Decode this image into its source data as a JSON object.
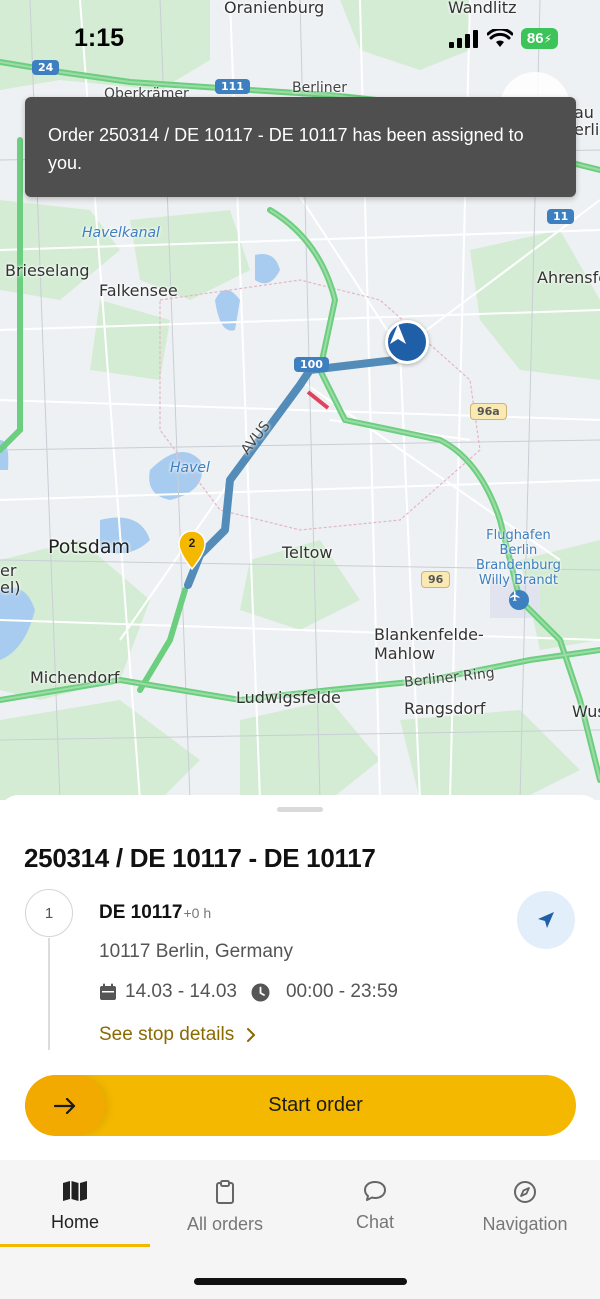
{
  "status_bar": {
    "time": "1:15",
    "battery": "86"
  },
  "map": {
    "labels": {
      "oranienburg": "Oranienburg",
      "wandlitz": "Wandlitz",
      "oberkramer": "Oberkrämer",
      "berlin_ring_top": "Berliner",
      "brieselang": "Brieselang",
      "falkensee": "Falkensee",
      "havelkanal": "Havelkanal",
      "ahrensfelde": "Ahrensfe",
      "havel": "Havel",
      "avus": "AVUS",
      "potsdam": "Potsdam",
      "teltow": "Teltow",
      "airport": "Flughafen\nBerlin\nBrandenburg\nWilly Brandt",
      "blankenfelde": "Blankenfelde-\nMahlow",
      "michendorf": "Michendorf",
      "ludwigsfelde": "Ludwigsfelde",
      "berliner_ring": "Berliner Ring",
      "rangsdorf": "Rangsdorf",
      "wus": "Wus",
      "left_edge": "er\nel)",
      "right_top": "au\nerli"
    },
    "shields": {
      "a24": "24",
      "a111": "111",
      "a11": "11",
      "a100": "100",
      "b96a": "96a",
      "b96": "96"
    },
    "stop_pin_number": "2"
  },
  "toast": {
    "message": "Order 250314 / DE 10117 - DE 10117 has been assigned to you."
  },
  "order": {
    "title": "250314 / DE 10117 - DE 10117",
    "stop": {
      "index": "1",
      "name": "DE 10117",
      "offset": "+0 h",
      "address": "10117 Berlin, Germany",
      "date_range": "14.03 - 14.03",
      "time_range": "00:00 - 23:59",
      "details_label": "See stop details"
    },
    "start_label": "Start order"
  },
  "tabs": [
    {
      "label": "Home",
      "icon": "map-icon",
      "active": true
    },
    {
      "label": "All orders",
      "icon": "clipboard-icon",
      "active": false
    },
    {
      "label": "Chat",
      "icon": "chat-bubble-icon",
      "active": false
    },
    {
      "label": "Navigation",
      "icon": "compass-icon",
      "active": false
    }
  ],
  "colors": {
    "accent": "#f5b800",
    "route": "#4a86b5",
    "location_marker": "#1f5fa8",
    "highway": "#6ccf7f",
    "details_link": "#8a6a00"
  }
}
